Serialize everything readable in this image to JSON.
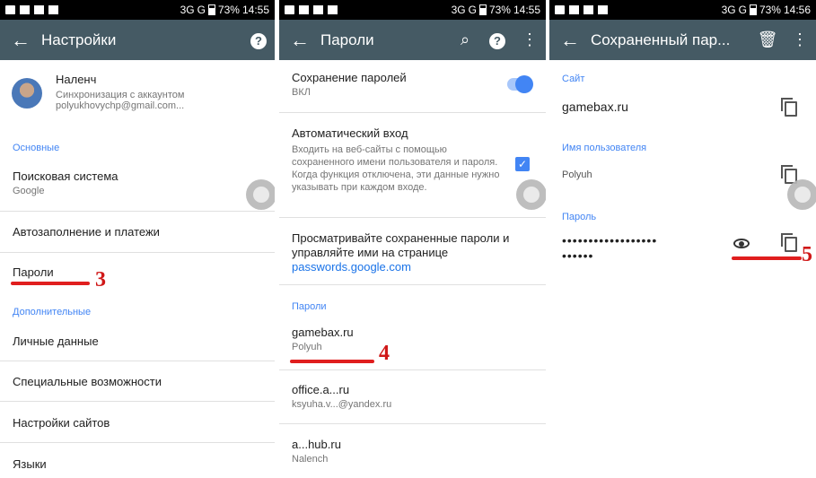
{
  "status": {
    "signal_text": "3G",
    "g_text": "G",
    "battery": "73%",
    "time_left": "14:55",
    "time_middle": "14:55",
    "time_right": "14:56"
  },
  "panel1": {
    "title": "Настройки",
    "profile": {
      "name": "Наленч",
      "sync": "Синхронизация с аккаунтом",
      "email": "polyukhovychp@gmail.com..."
    },
    "section_basic": "Основные",
    "search_engine": {
      "label": "Поисковая система",
      "value": "Google"
    },
    "autofill": "Автозаполнение и платежи",
    "passwords": "Пароли",
    "section_more": "Дополнительные",
    "personal": "Личные данные",
    "accessibility": "Специальные возможности",
    "site_settings": "Настройки сайтов",
    "languages": "Языки",
    "marker": "3"
  },
  "panel2": {
    "title": "Пароли",
    "save_passwords": {
      "label": "Сохранение паролей",
      "state": "ВКЛ"
    },
    "auto_signin": {
      "label": "Автоматический вход",
      "desc": "Входить на веб-сайты с помощью сохраненного имени пользователя и пароля. Когда функция отключена, эти данные нужно указывать при каждом входе."
    },
    "view_saved": {
      "text": "Просматривайте сохраненные пароли и управляйте ими на странице",
      "link": "passwords.google.com"
    },
    "section_passwords": "Пароли",
    "entries": [
      {
        "site": "gamebax.ru",
        "user": "Polyuh"
      },
      {
        "site": "office.a...ru",
        "user": "ksyuha.v...@yandex.ru"
      },
      {
        "site": "a...hub.ru",
        "user": "Nalench"
      }
    ],
    "marker": "4"
  },
  "panel3": {
    "title": "Сохраненный пар...",
    "site_label": "Сайт",
    "site_value": "gamebax.ru",
    "user_label": "Имя пользователя",
    "user_value": "Polyuh",
    "pass_label": "Пароль",
    "pass_line1": "••••••••••••••••••",
    "pass_line2": "••••••",
    "marker": "5"
  },
  "colors": {
    "toolbar": "#455a64",
    "accent": "#4285f4",
    "annotation": "#e01e1e"
  }
}
